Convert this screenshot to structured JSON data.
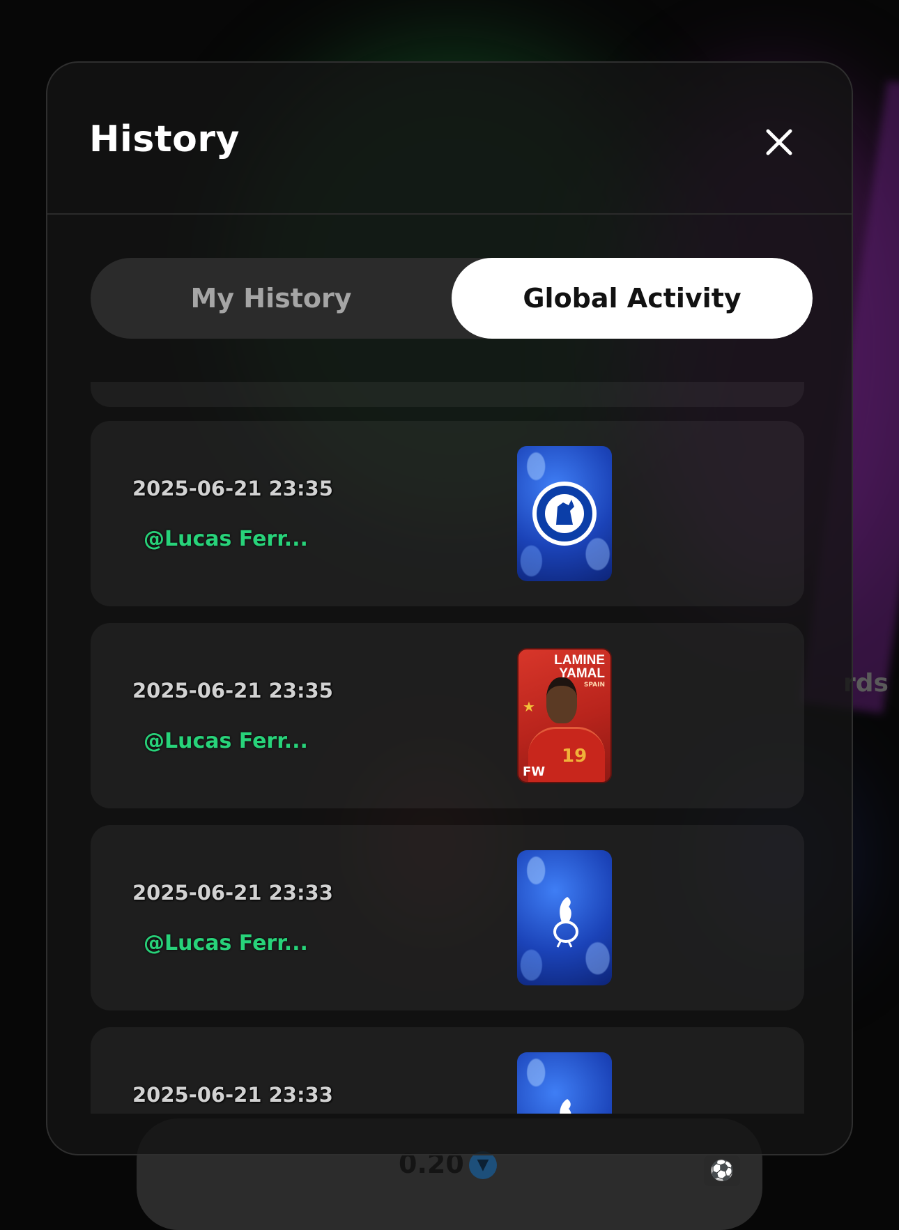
{
  "modal": {
    "title": "History",
    "close_icon": "close-icon"
  },
  "tabs": [
    {
      "label": "My History",
      "active": false
    },
    {
      "label": "Global Activity",
      "active": true
    }
  ],
  "activity": [
    {
      "timestamp": "2025-06-21 23:35",
      "user": "@Lucas Ferr...",
      "card": "chelsea-club-card",
      "card_label": "CHELSEA FOOTBALL CLUB"
    },
    {
      "timestamp": "2025-06-21 23:35",
      "user": "@Lucas Ferr...",
      "card": "player-card",
      "player_name": "LAMINE YAMAL",
      "country": "SPAIN",
      "position": "FW",
      "number": "19"
    },
    {
      "timestamp": "2025-06-21 23:33",
      "user": "@Lucas Ferr...",
      "card": "tottenham-club-card"
    },
    {
      "timestamp": "2025-06-21 23:33",
      "user": "",
      "card": "tottenham-club-card"
    }
  ],
  "bottom_bar": {
    "price": "0.20",
    "token_icon": "ton-token-icon",
    "action_icon": "soccer-ball-icon"
  },
  "background": {
    "side_text": "rds"
  },
  "colors": {
    "username": "#28d37a",
    "active_tab_bg": "#ffffff",
    "inactive_tab_text": "#a5a5a5"
  }
}
